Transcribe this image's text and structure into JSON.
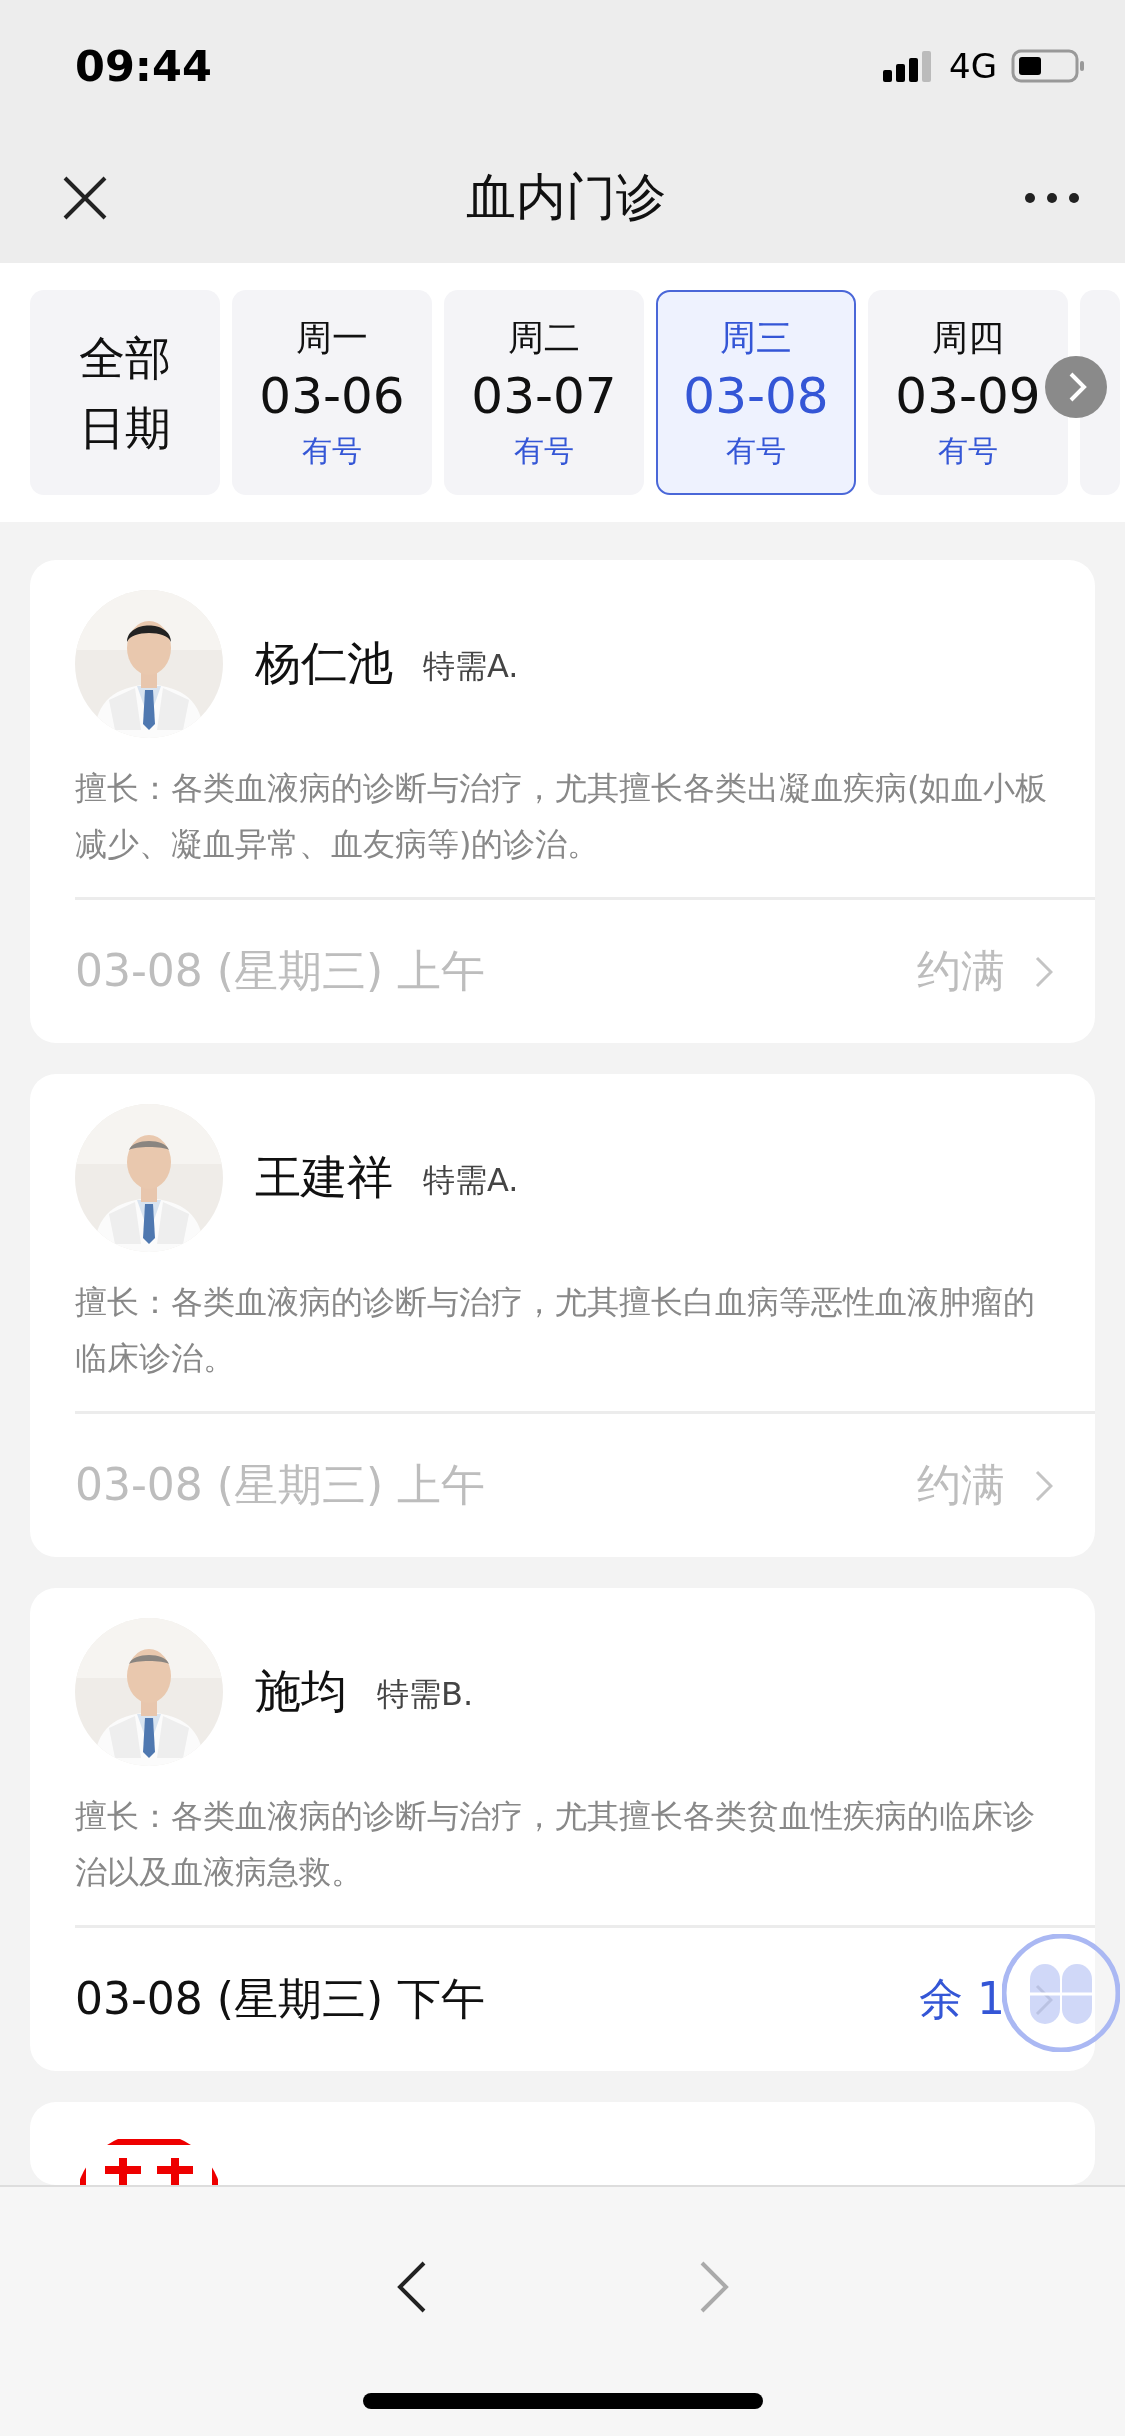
{
  "status_bar": {
    "time": "09:44",
    "network": "4G"
  },
  "nav": {
    "title": "血内门诊"
  },
  "dates": [
    {
      "kind": "all",
      "label": "全部日期",
      "selected": false
    },
    {
      "kind": "day",
      "weekday": "周一",
      "date": "03-06",
      "availability": "有号",
      "selected": false
    },
    {
      "kind": "day",
      "weekday": "周二",
      "date": "03-07",
      "availability": "有号",
      "selected": false
    },
    {
      "kind": "day",
      "weekday": "周三",
      "date": "03-08",
      "availability": "有号",
      "selected": true
    },
    {
      "kind": "day",
      "weekday": "周四",
      "date": "03-09",
      "availability": "有号",
      "selected": false
    }
  ],
  "doctors": [
    {
      "name": "杨仁池",
      "title": "特需A.",
      "specialty": "擅长：各类血液病的诊断与治疗，尤其擅长各类出凝血疾病(如血小板减少、凝血异常、血友病等)的诊治。",
      "slot": "03-08 (星期三)  上午",
      "status": "约满",
      "available": false
    },
    {
      "name": "王建祥",
      "title": "特需A.",
      "specialty": "擅长：各类血液病的诊断与治疗，尤其擅长白血病等恶性血液肿瘤的临床诊治。",
      "slot": "03-08 (星期三)  上午",
      "status": "约满",
      "available": false
    },
    {
      "name": "施均",
      "title": "特需B.",
      "specialty": "擅长：各类血液病的诊断与治疗，尤其擅长各类贫血性疾病的临床诊治以及血液病急救。",
      "slot": "03-08 (星期三)  下午",
      "status": "余 1",
      "available": true
    }
  ]
}
